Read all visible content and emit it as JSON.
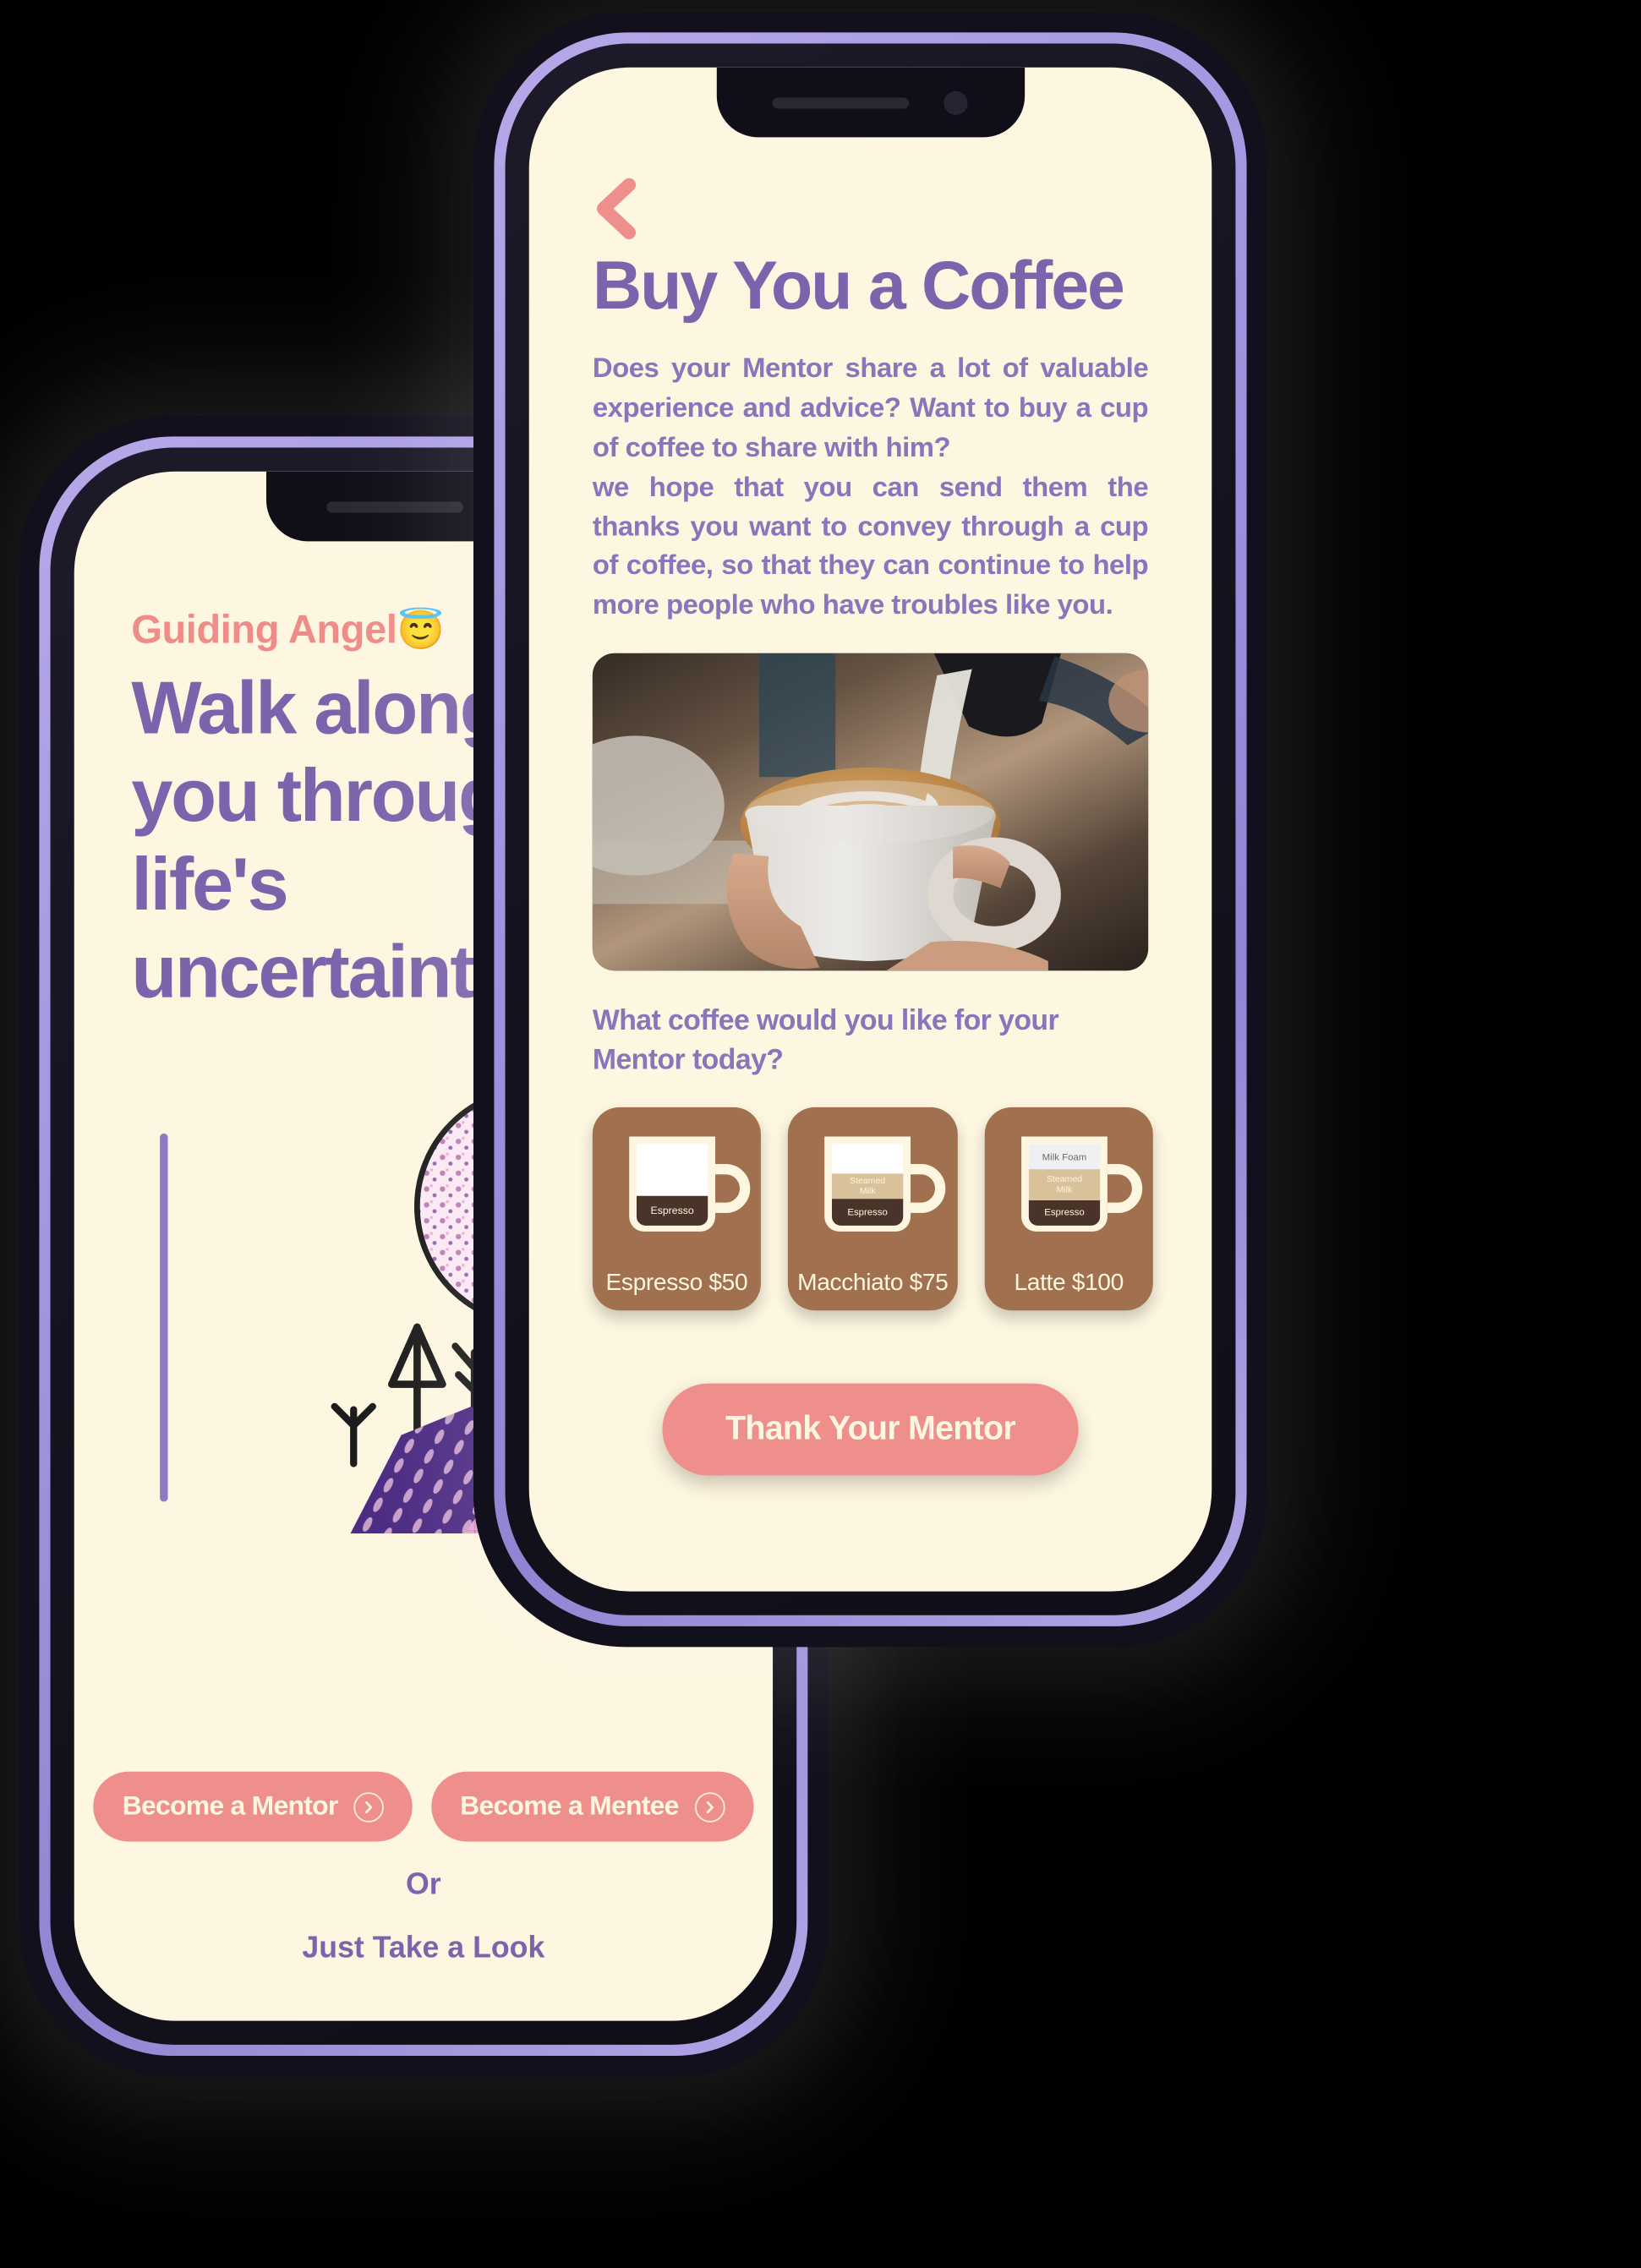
{
  "landing_screen": {
    "brand": "Guiding Angel",
    "brand_emoji": "😇",
    "headline": "Walk alongside you through life's uncertainties.",
    "primary_button": "Become a Mentor",
    "secondary_button": "Become a Mentee",
    "or_label": "Or",
    "tertiary_link": "Just Take a Look",
    "illustration_name": "moon-trees-mountains-illustration"
  },
  "coffee_screen": {
    "back_icon": "chevron-left-icon",
    "title": "Buy You a Coffee",
    "paragraph_1": "Does your Mentor share a lot of valuable experience and advice? Want to buy a cup of coffee to share with him?",
    "paragraph_2": "we hope that you can send them the thanks you want to convey through a cup of coffee, so that they can continue to help more people who have troubles like you.",
    "hero_photo_alt": "latte-art-pour-photo",
    "question": "What coffee would you like for your Mentor today?",
    "options": [
      {
        "name": "Espresso",
        "price": "$50",
        "label": "Espresso $50",
        "layers": [
          "Espresso"
        ]
      },
      {
        "name": "Macchiato",
        "price": "$75",
        "label": "Macchiato $75",
        "layers": [
          "Steamed Milk",
          "Espresso"
        ]
      },
      {
        "name": "Latte",
        "price": "$100",
        "label": "Latte $100",
        "layers": [
          "Milk Foam",
          "Steamed Milk",
          "Espresso"
        ]
      }
    ],
    "cta_button": "Thank Your Mentor"
  },
  "colors": {
    "background": "#000000",
    "screen_bg": "#fdf6e0",
    "purple": "#7d63ab",
    "purple_body": "#8a74bb",
    "coral": "#ef8f8c",
    "brand_coral": "#ef8c88",
    "card_brown": "#a1714f",
    "bezel_purple": "#a294df"
  }
}
